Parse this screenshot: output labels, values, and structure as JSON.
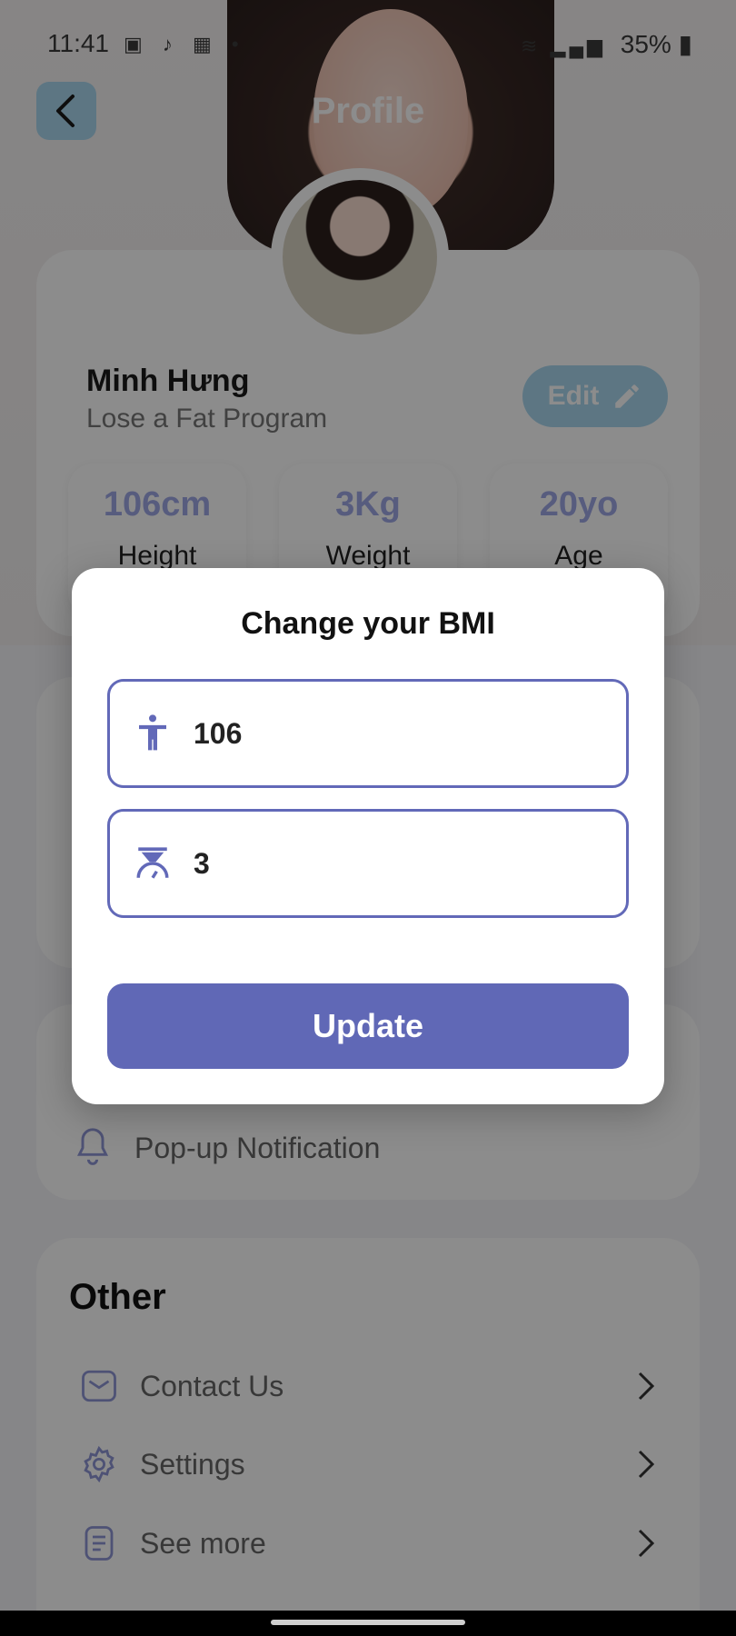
{
  "statusbar": {
    "time": "11:41",
    "battery": "35%"
  },
  "header": {
    "title": "Profile"
  },
  "profile": {
    "name": "Minh Hưng",
    "program": "Lose a Fat Program",
    "edit_label": "Edit",
    "stats": [
      {
        "value": "106cm",
        "label": "Height"
      },
      {
        "value": "3Kg",
        "label": "Weight"
      },
      {
        "value": "20yo",
        "label": "Age"
      }
    ]
  },
  "notification": {
    "label": "Pop-up Notification"
  },
  "other": {
    "title": "Other",
    "items": [
      {
        "label": "Contact Us",
        "icon": "mail-icon"
      },
      {
        "label": "Settings",
        "icon": "gear-icon"
      },
      {
        "label": "See more",
        "icon": "document-icon"
      }
    ]
  },
  "modal": {
    "title": "Change your BMI",
    "height_value": "106",
    "weight_value": "3",
    "update_label": "Update"
  },
  "colors": {
    "accent": "#6068b6",
    "field_border": "#6269b8",
    "light_blue": "#a9d7ef",
    "stat_value": "#9fa8e6"
  }
}
